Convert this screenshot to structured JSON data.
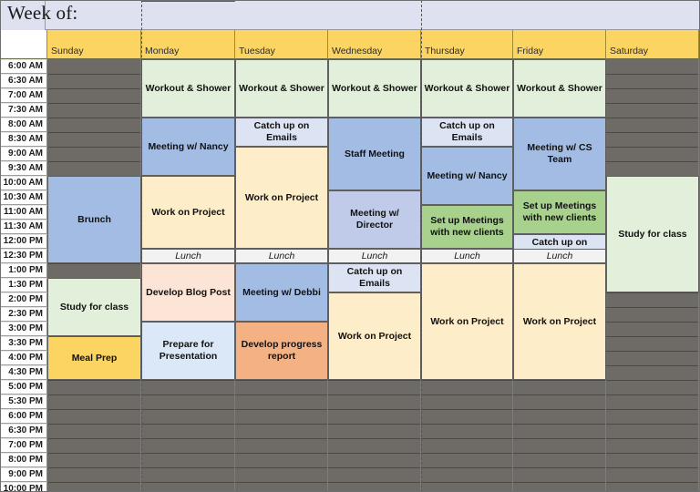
{
  "header": {
    "title": "Week of:",
    "days": [
      "Sunday",
      "Monday",
      "Tuesday",
      "Wednesday",
      "Thursday",
      "Friday",
      "Saturday"
    ]
  },
  "times": [
    "6:00 AM",
    "6:30 AM",
    "7:00 AM",
    "7:30 AM",
    "8:00 AM",
    "8:30 AM",
    "9:00 AM",
    "9:30 AM",
    "10:00 AM",
    "10:30 AM",
    "11:00 AM",
    "11:30 AM",
    "12:00 PM",
    "12:30 PM",
    "1:00 PM",
    "1:30 PM",
    "2:00 PM",
    "2:30 PM",
    "3:00 PM",
    "3:30 PM",
    "4:00 PM",
    "4:30 PM",
    "5:00 PM",
    "5:30 PM",
    "6:00 PM",
    "6:30 PM",
    "7:00 PM",
    "8:00 PM",
    "9:00 PM",
    "10:00 PM"
  ],
  "colors": {
    "header_band": "#dde1f0",
    "day_header": "#fcd462",
    "blocked": "#6e6b66",
    "green": "#e2efda",
    "green_strong": "#a9d18e",
    "blue": "#a3bce3",
    "blue_light": "#dce3f2",
    "blue_pale": "#dbe8f7",
    "cream": "#fdeec9",
    "peach": "#fce4d6",
    "orange": "#f4b183",
    "yellow": "#fcd462",
    "lunch": "#f2f2f2"
  },
  "events": [
    {
      "day": 0,
      "start": 8,
      "end": 14,
      "label": "Brunch",
      "color": "#a3bce3"
    },
    {
      "day": 0,
      "start": 15,
      "end": 19,
      "label": "Study for class",
      "color": "#e2efda"
    },
    {
      "day": 0,
      "start": 19,
      "end": 22,
      "label": "Meal Prep",
      "color": "#fcd462"
    },
    {
      "day": 1,
      "start": 0,
      "end": 4,
      "label": "Workout & Shower",
      "color": "#e2efda"
    },
    {
      "day": 1,
      "start": 4,
      "end": 8,
      "label": "Meeting w/ Nancy",
      "color": "#a3bce3"
    },
    {
      "day": 1,
      "start": 8,
      "end": 13,
      "label": "Work on Project",
      "color": "#fdeec9"
    },
    {
      "day": 1,
      "start": 13,
      "end": 14,
      "label": "Lunch",
      "color": "#f2f2f2"
    },
    {
      "day": 1,
      "start": 14,
      "end": 18,
      "label": "Develop Blog Post",
      "color": "#fce4d6"
    },
    {
      "day": 1,
      "start": 18,
      "end": 22,
      "label": "Prepare for Presentation",
      "color": "#dbe8f7"
    },
    {
      "day": 2,
      "start": 0,
      "end": 4,
      "label": "Workout & Shower",
      "color": "#e2efda"
    },
    {
      "day": 2,
      "start": 4,
      "end": 6,
      "label": "Catch up on Emails",
      "color": "#dce3f2"
    },
    {
      "day": 2,
      "start": 6,
      "end": 13,
      "label": "Work on Project",
      "color": "#fdeec9"
    },
    {
      "day": 2,
      "start": 13,
      "end": 14,
      "label": "Lunch",
      "color": "#f2f2f2"
    },
    {
      "day": 2,
      "start": 14,
      "end": 18,
      "label": "Meeting w/ Debbi",
      "color": "#a3bce3"
    },
    {
      "day": 2,
      "start": 18,
      "end": 22,
      "label": "Develop progress report",
      "color": "#f4b183"
    },
    {
      "day": 3,
      "start": 0,
      "end": 4,
      "label": "Workout & Shower",
      "color": "#e2efda"
    },
    {
      "day": 3,
      "start": 4,
      "end": 9,
      "label": "Staff Meeting",
      "color": "#a3bce3"
    },
    {
      "day": 3,
      "start": 9,
      "end": 13,
      "label": "Meeting w/ Director",
      "color": "#bfcbe8"
    },
    {
      "day": 3,
      "start": 13,
      "end": 14,
      "label": "Lunch",
      "color": "#f2f2f2"
    },
    {
      "day": 3,
      "start": 14,
      "end": 16,
      "label": "Catch up on Emails",
      "color": "#dce3f2"
    },
    {
      "day": 3,
      "start": 16,
      "end": 22,
      "label": "Work on Project",
      "color": "#fdeec9"
    },
    {
      "day": 4,
      "start": 0,
      "end": 4,
      "label": "Workout & Shower",
      "color": "#e2efda"
    },
    {
      "day": 4,
      "start": 4,
      "end": 6,
      "label": "Catch up on Emails",
      "color": "#dce3f2"
    },
    {
      "day": 4,
      "start": 6,
      "end": 10,
      "label": "Meeting w/ Nancy",
      "color": "#a3bce3"
    },
    {
      "day": 4,
      "start": 10,
      "end": 13,
      "label": "Set up Meetings with new clients",
      "color": "#a9d18e"
    },
    {
      "day": 4,
      "start": 13,
      "end": 14,
      "label": "Lunch",
      "color": "#f2f2f2"
    },
    {
      "day": 4,
      "start": 14,
      "end": 22,
      "label": "Work on Project",
      "color": "#fdeec9"
    },
    {
      "day": 5,
      "start": 0,
      "end": 4,
      "label": "Workout & Shower",
      "color": "#e2efda"
    },
    {
      "day": 5,
      "start": 4,
      "end": 9,
      "label": "Meeting w/ CS Team",
      "color": "#a3bce3"
    },
    {
      "day": 5,
      "start": 9,
      "end": 12,
      "label": "Set up Meetings with new clients",
      "color": "#a9d18e"
    },
    {
      "day": 5,
      "start": 12,
      "end": 14,
      "label": "Catch up on Emails",
      "color": "#dce3f2"
    },
    {
      "day": 5,
      "start": 13,
      "end": 14,
      "label": "Lunch",
      "color": "#f2f2f2"
    },
    {
      "day": 5,
      "start": 14,
      "end": 22,
      "label": "Work on Project",
      "color": "#fdeec9"
    },
    {
      "day": 6,
      "start": 8,
      "end": 16,
      "label": "Study for class",
      "color": "#e2efda"
    }
  ]
}
